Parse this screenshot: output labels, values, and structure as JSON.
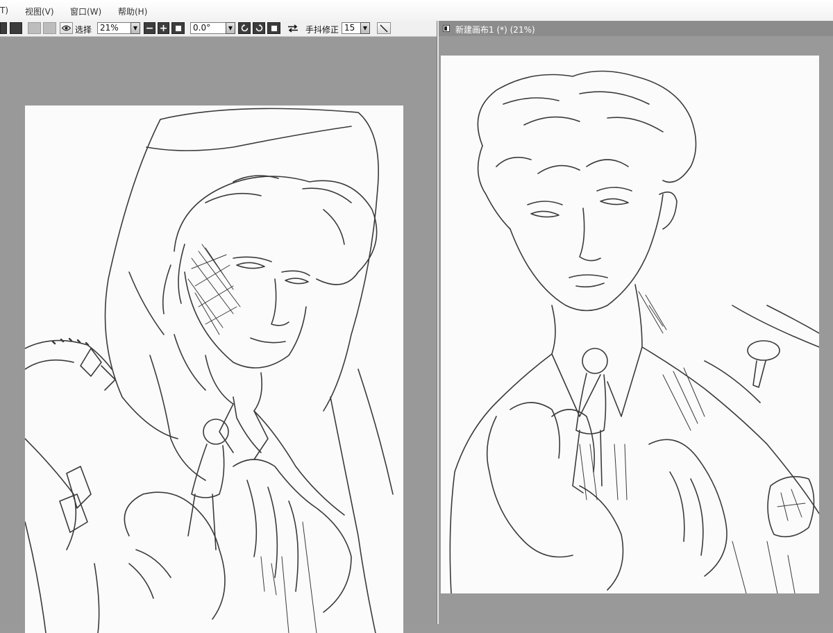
{
  "menubar": {
    "items": [
      {
        "label": "T)"
      },
      {
        "label": "视图(V)"
      },
      {
        "label": "窗口(W)"
      },
      {
        "label": "帮助(H)"
      }
    ]
  },
  "toolbar": {
    "view_mode_label": "选择",
    "zoom_value": "21%",
    "rotation_value": "0.0°",
    "stabilizer_label": "手抖修正",
    "stabilizer_value": "15",
    "zoom_out_symbol": "−",
    "zoom_in_symbol": "+"
  },
  "document_right": {
    "title": "新建画布1 (*) (21%)"
  },
  "colors": {
    "workspace_bg": "#9a9a9a",
    "paper": "#fbfbfb",
    "title_bar": "#8c8c8c",
    "line_art": "#3a3a3a"
  },
  "icons": {
    "eye": "eye-icon",
    "rotate_left": "rotate-left-icon",
    "rotate_right": "rotate-right-icon",
    "flip": "flip-horizontal-icon",
    "pen": "pen-line-icon"
  }
}
